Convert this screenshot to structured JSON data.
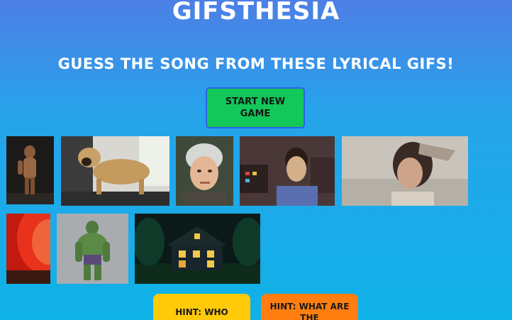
{
  "header": {
    "title": "GIFSTHESIA",
    "subtitle": "GUESS THE SONG FROM THESE LYRICAL GIFS!"
  },
  "controls": {
    "start_label": "START NEW GAME"
  },
  "hints": [
    {
      "label": "HINT: WHO"
    },
    {
      "label": "HINT: WHAT ARE THE"
    }
  ],
  "colors": {
    "start_button": "#12c85a",
    "hint_who": "#ffca0a",
    "hint_what": "#ff7e0f"
  }
}
